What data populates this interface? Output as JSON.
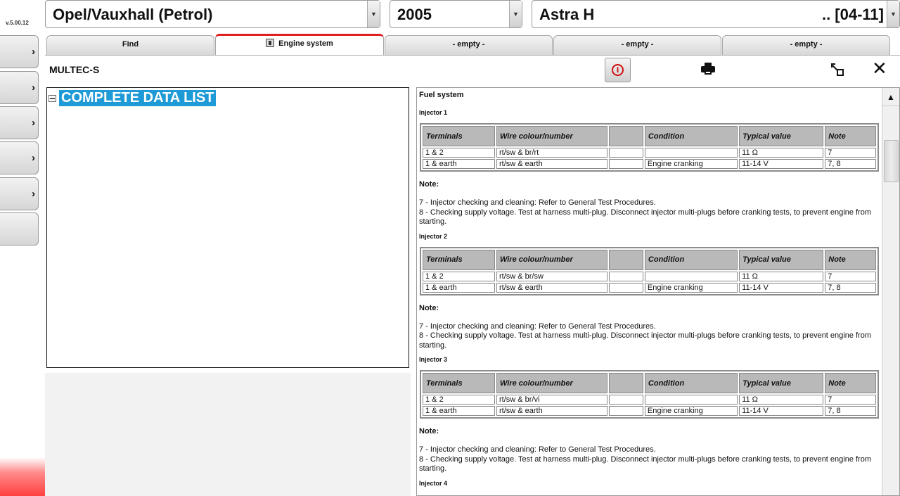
{
  "app": {
    "version": "v.5.00.12"
  },
  "selectors": {
    "make": "Opel/Vauxhall (Petrol)",
    "year": "2005",
    "model": "Astra H",
    "model_range": ".. [04-11]"
  },
  "tabs": [
    {
      "label": "Find"
    },
    {
      "label": "Engine system"
    },
    {
      "label": "- empty -"
    },
    {
      "label": "- empty -"
    },
    {
      "label": "- empty -"
    }
  ],
  "toolbar": {
    "module": "MULTEC-S",
    "info_glyph": "i"
  },
  "tree": {
    "root_label": "COMPLETE DATA LIST"
  },
  "doc": {
    "section_title": "Fuel system",
    "columns": [
      "Terminals",
      "Wire colour/number",
      "",
      "Condition",
      "Typical value",
      "Note"
    ],
    "note_heading": "Note:",
    "note_lines": [
      "7 - Injector checking and cleaning: Refer to General Test Procedures.",
      "8 - Checking supply voltage. Test at harness multi-plug. Disconnect injector multi-plugs before cranking tests, to prevent engine from starting."
    ],
    "injectors": [
      {
        "title": "Injector 1",
        "rows": [
          [
            "1 & 2",
            "rt/sw & br/rt",
            "",
            "",
            "11 Ω",
            "7"
          ],
          [
            "1 & earth",
            "rt/sw & earth",
            "",
            "Engine cranking",
            "11-14 V",
            "7, 8"
          ]
        ]
      },
      {
        "title": "Injector 2",
        "rows": [
          [
            "1 & 2",
            "rt/sw & br/sw",
            "",
            "",
            "11 Ω",
            "7"
          ],
          [
            "1 & earth",
            "rt/sw & earth",
            "",
            "Engine cranking",
            "11-14 V",
            "7, 8"
          ]
        ]
      },
      {
        "title": "Injector 3",
        "rows": [
          [
            "1 & 2",
            "rt/sw & br/vi",
            "",
            "",
            "11 Ω",
            "7"
          ],
          [
            "1 & earth",
            "rt/sw & earth",
            "",
            "Engine cranking",
            "11-14 V",
            "7, 8"
          ]
        ]
      }
    ],
    "next_title": "Injector 4"
  }
}
